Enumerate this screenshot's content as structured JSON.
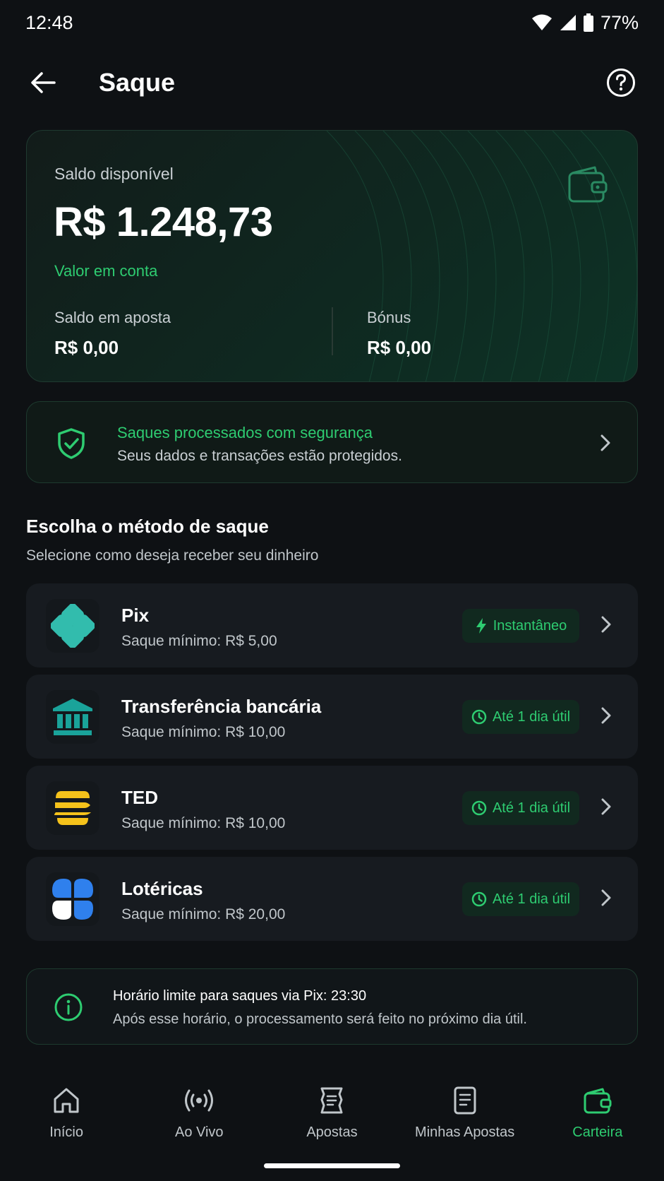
{
  "status_bar": {
    "time": "12:48",
    "battery": "77%"
  },
  "app_bar": {
    "title": "Saque"
  },
  "balance": {
    "label": "Saldo disponível",
    "value": "R$ 1.248,73",
    "note": "Valor em conta",
    "bet_label": "Saldo em aposta",
    "bet_value": "R$ 0,00",
    "bonus_label": "Bónus",
    "bonus_value": "R$ 0,00"
  },
  "security": {
    "title": "Saques processados com segurança",
    "description": "Seus dados e transações estão protegidos."
  },
  "methods_section": {
    "title": "Escolha o método de saque",
    "subtitle": "Selecione como deseja receber seu dinheiro",
    "items": [
      {
        "name": "Pix",
        "minimum": "Saque mínimo: R$ 5,00",
        "badge": "Instantâneo",
        "badge_icon": "bolt-icon",
        "icon": "pix-icon"
      },
      {
        "name": "Transferência bancária",
        "minimum": "Saque mínimo: R$ 10,00",
        "badge": "Até 1 dia útil",
        "badge_icon": "clock-icon",
        "icon": "bank-icon"
      },
      {
        "name": "TED",
        "minimum": "Saque mínimo: R$ 10,00",
        "badge": "Até 1 dia útil",
        "badge_icon": "clock-icon",
        "icon": "ted-icon"
      },
      {
        "name": "Lotéricas",
        "minimum": "Saque mínimo: R$ 20,00",
        "badge": "Até 1 dia útil",
        "badge_icon": "clock-icon",
        "icon": "clover-icon"
      }
    ]
  },
  "info": {
    "title": "Horário limite para saques via Pix: 23:30",
    "description": "Após esse horário, o processamento será feito no próximo dia útil."
  },
  "bottom_nav": {
    "items": [
      {
        "label": "Início",
        "icon": "home-icon",
        "active": false
      },
      {
        "label": "Ao Vivo",
        "icon": "live-icon",
        "active": false
      },
      {
        "label": "Apostas",
        "icon": "ticket-icon",
        "active": false
      },
      {
        "label": "Minhas Apostas",
        "icon": "document-icon",
        "active": false
      },
      {
        "label": "Carteira",
        "icon": "wallet-icon",
        "active": true
      }
    ]
  },
  "colors": {
    "accent": "#2ecc71",
    "background": "#0e1114",
    "card": "#171b20"
  }
}
